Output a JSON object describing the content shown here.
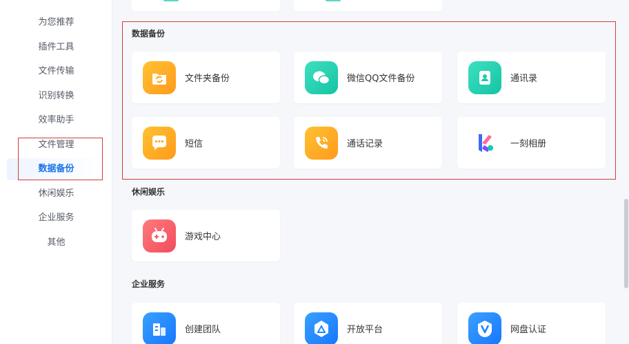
{
  "sidebar": {
    "items": [
      {
        "label": "为您推荐"
      },
      {
        "label": "插件工具"
      },
      {
        "label": "文件传输"
      },
      {
        "label": "识别转换"
      },
      {
        "label": "效率助手"
      },
      {
        "label": "文件管理"
      },
      {
        "label": "数据备份",
        "active": true
      },
      {
        "label": "休闲娱乐"
      },
      {
        "label": "企业服务"
      },
      {
        "label": "其他"
      }
    ]
  },
  "sections": {
    "backup": {
      "title": "数据备份",
      "items": [
        {
          "label": "文件夹备份",
          "icon": "folder-sync-icon"
        },
        {
          "label": "微信QQ文件备份",
          "icon": "chat-bubbles-icon"
        },
        {
          "label": "通讯录",
          "icon": "contact-book-icon"
        },
        {
          "label": "短信",
          "icon": "sms-icon"
        },
        {
          "label": "通话记录",
          "icon": "phone-call-icon"
        },
        {
          "label": "一刻相册",
          "icon": "yike-album-icon"
        }
      ]
    },
    "leisure": {
      "title": "休闲娱乐",
      "items": [
        {
          "label": "游戏中心",
          "icon": "gamepad-icon"
        }
      ]
    },
    "enterprise": {
      "title": "企业服务",
      "items": [
        {
          "label": "创建团队",
          "icon": "team-building-icon"
        },
        {
          "label": "开放平台",
          "icon": "open-platform-icon"
        },
        {
          "label": "网盘认证",
          "icon": "verified-v-icon"
        }
      ]
    }
  },
  "colors": {
    "accent": "#1a73e8",
    "highlight_border": "#d23a3a"
  }
}
